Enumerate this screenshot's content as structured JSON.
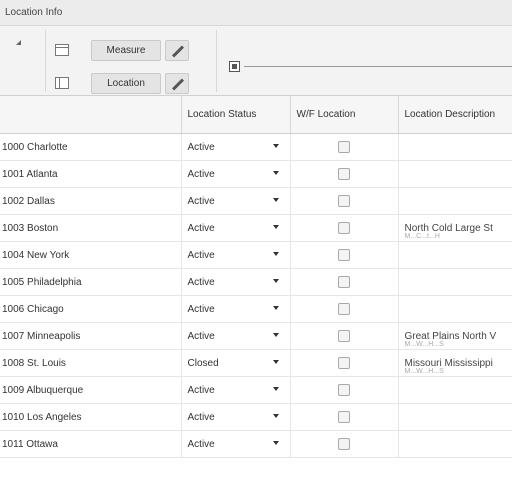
{
  "window": {
    "title": "Location Info"
  },
  "pivot": {
    "measure_label": "Measure",
    "location_label": "Location"
  },
  "columns": [
    "Location Status",
    "W/F Location",
    "Location Description"
  ],
  "rows": [
    {
      "name": "1000 Charlotte",
      "status": "Active",
      "wf": false,
      "desc": "",
      "desc_overflow": ""
    },
    {
      "name": "1001 Atlanta",
      "status": "Active",
      "wf": false,
      "desc": "",
      "desc_overflow": ""
    },
    {
      "name": "1002 Dallas",
      "status": "Active",
      "wf": false,
      "desc": "",
      "desc_overflow": ""
    },
    {
      "name": "1003 Boston",
      "status": "Active",
      "wf": false,
      "desc": "North Cold Large St",
      "desc_overflow": "M...C...t...H"
    },
    {
      "name": "1004 New York",
      "status": "Active",
      "wf": false,
      "desc": "",
      "desc_overflow": ""
    },
    {
      "name": "1005 Philadelphia",
      "status": "Active",
      "wf": false,
      "desc": "",
      "desc_overflow": ""
    },
    {
      "name": "1006 Chicago",
      "status": "Active",
      "wf": false,
      "desc": "",
      "desc_overflow": ""
    },
    {
      "name": "1007 Minneapolis",
      "status": "Active",
      "wf": false,
      "desc": "Great Plains North V",
      "desc_overflow": "M...W...H...S"
    },
    {
      "name": "1008 St. Louis",
      "status": "Closed",
      "wf": false,
      "desc": "Missouri Mississippi",
      "desc_overflow": "M...W...H...S"
    },
    {
      "name": "1009 Albuquerque",
      "status": "Active",
      "wf": false,
      "desc": "",
      "desc_overflow": ""
    },
    {
      "name": "1010 Los Angeles",
      "status": "Active",
      "wf": false,
      "desc": "",
      "desc_overflow": ""
    },
    {
      "name": "1011 Ottawa",
      "status": "Active",
      "wf": false,
      "desc": "",
      "desc_overflow": ""
    }
  ]
}
